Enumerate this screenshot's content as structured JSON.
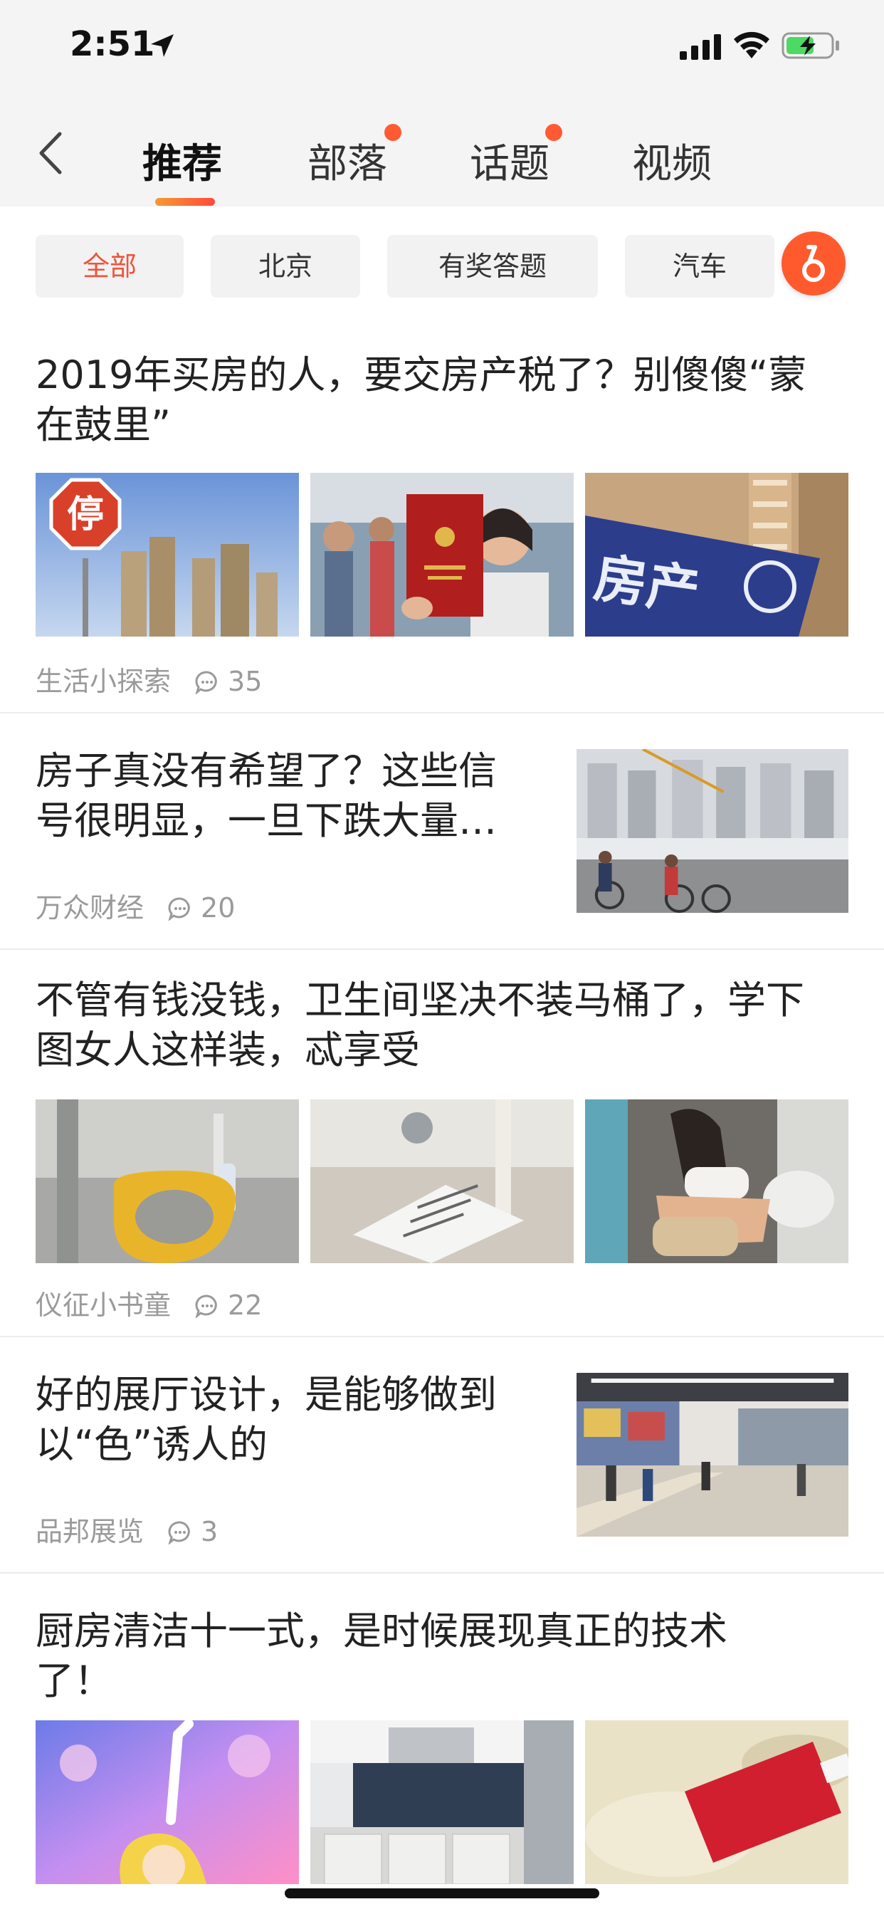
{
  "status_bar": {
    "time": "2:51"
  },
  "nav": {
    "tabs": [
      {
        "label": "推荐",
        "active": true,
        "dot": false
      },
      {
        "label": "部落",
        "active": false,
        "dot": true
      },
      {
        "label": "话题",
        "active": false,
        "dot": true
      },
      {
        "label": "视频",
        "active": false,
        "dot": false
      }
    ]
  },
  "filters": {
    "chips": [
      "全部",
      "北京",
      "有奖答题",
      "汽车"
    ],
    "selected": "全部"
  },
  "articles": [
    {
      "title_line1": "2019年买房的人，要交房产税了？别傻傻“蒙",
      "title_line2": "在鼓里”",
      "source": "生活小探索",
      "comments": "35",
      "images": [
        {
          "caption": "停"
        },
        {
          "caption": ""
        },
        {
          "caption": "房产"
        }
      ]
    },
    {
      "title_line1": "房子真没有希望了？这些信",
      "title_line2": "号很明显，一旦下跌大量…",
      "source": "万众财经",
      "comments": "20"
    },
    {
      "title_line1": "不管有钱没钱，卫生间坚决不装马桶了，学下",
      "title_line2": "图女人这样装，忒享受",
      "source": "仪征小书童",
      "comments": "22"
    },
    {
      "title_line1": "好的展厅设计，是能够做到",
      "title_line2": "以“色”诱人的",
      "source": "品邦展览",
      "comments": "3"
    },
    {
      "title_line1": "厨房清洁十一式，是时候展现真正的技术",
      "title_line2": "了！"
    }
  ],
  "colors": {
    "accent": "#f0533c",
    "tab_underline_start": "#f59a33",
    "tab_underline_end": "#ff4a3a"
  }
}
